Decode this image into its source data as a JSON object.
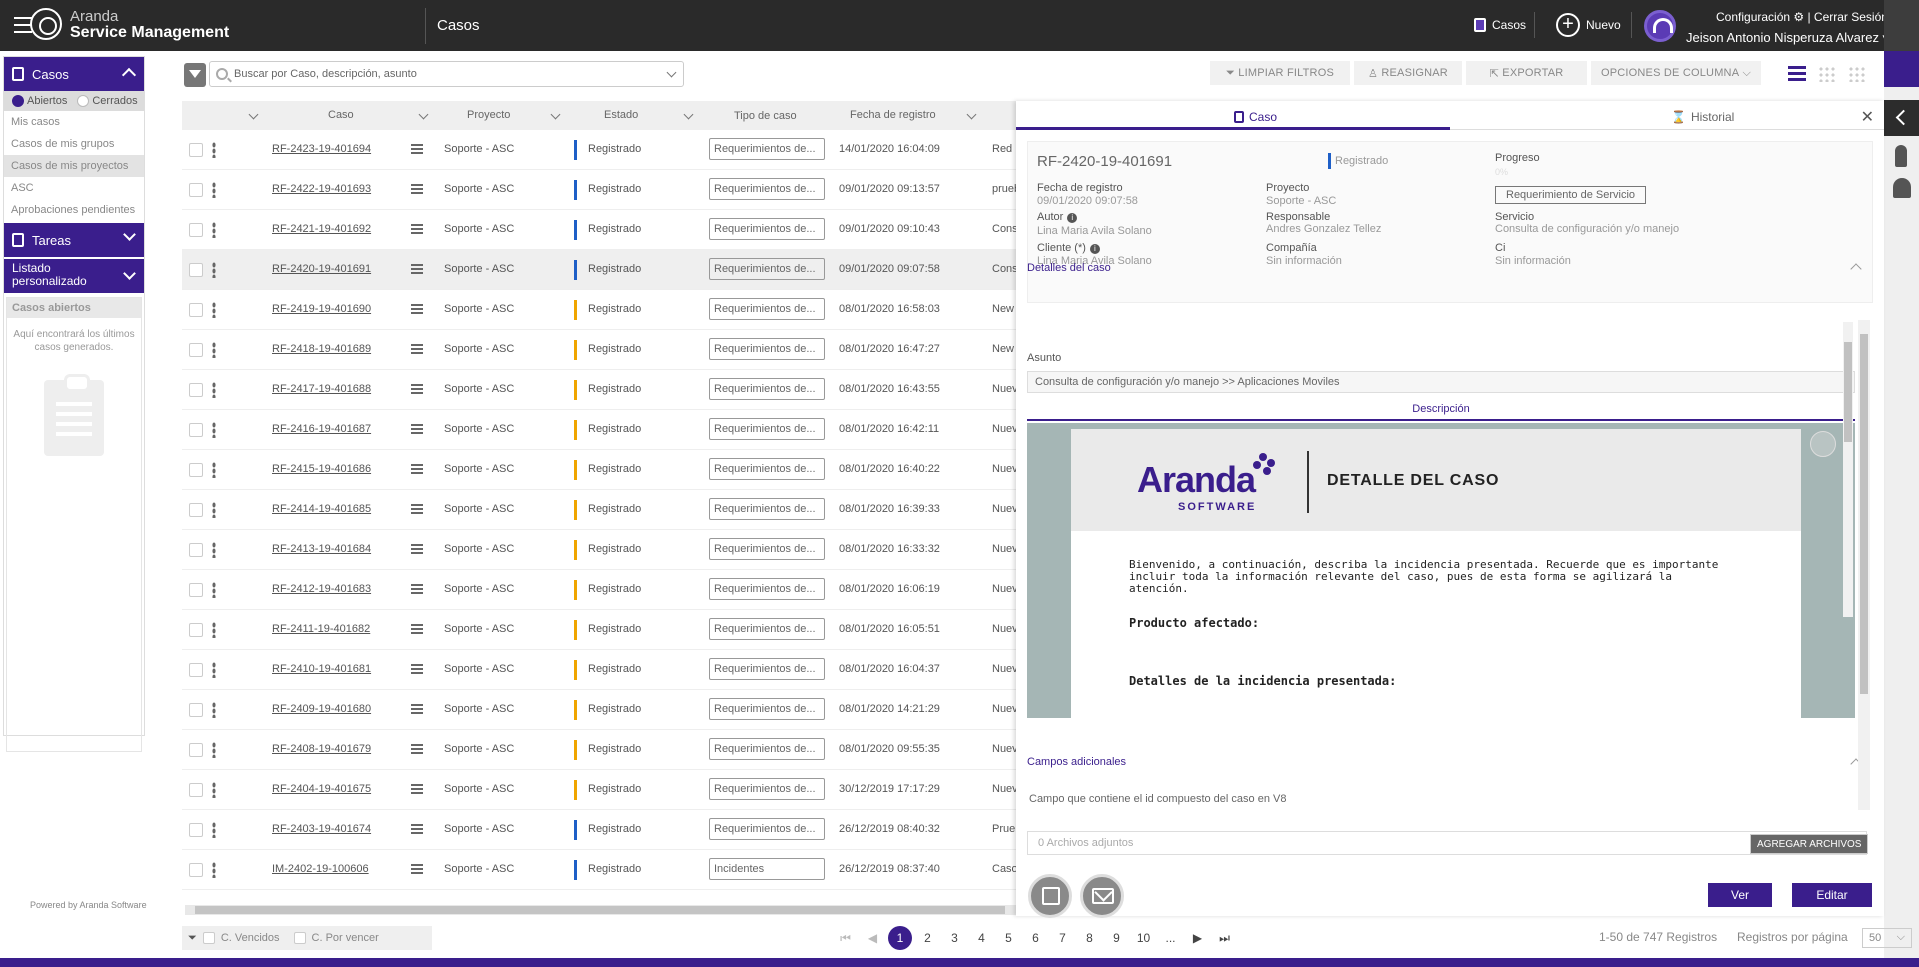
{
  "app": {
    "brand_line1": "Aranda",
    "brand_line2": "Service Management",
    "module_title": "Casos"
  },
  "topbar": {
    "casos_label": "Casos",
    "nuevo_label": "Nuevo",
    "config_label": "Configuración ⚙ | Cerrar Sesión",
    "user_name": "Jeison Antonio Nisperuza Alvarez ▾"
  },
  "sidebar": {
    "casos_label": "Casos",
    "radio_abiertos": "Abiertos",
    "radio_cerrados": "Cerrados",
    "links": [
      "Mis casos",
      "Casos de mis grupos",
      "Casos de mis proyectos",
      "ASC",
      "Aprobaciones pendientes"
    ],
    "tareas_label": "Tareas",
    "listado_label": "Listado personalizado",
    "card_title": "Casos abiertos",
    "card_text": "Aquí encontrará los últimos casos generados.",
    "powered": "Powered by Aranda Software"
  },
  "toolbar": {
    "search_placeholder": "Buscar por Caso, descripción, asunto",
    "limpiar": "LIMPIAR FILTROS",
    "reasignar": "REASIGNAR",
    "exportar": "EXPORTAR",
    "opciones": "OPCIONES DE COLUMNA"
  },
  "grid": {
    "headers": {
      "caso": "Caso",
      "proyecto": "Proyecto",
      "estado": "Estado",
      "tipo": "Tipo de caso",
      "fecha": "Fecha de registro"
    },
    "rows": [
      {
        "id": "RF-2423-19-401694",
        "proyecto": "Soporte - ASC",
        "estado": "Registrado",
        "tipo": "Requerimientos de...",
        "fecha": "14/01/2020 16:04:09",
        "extra": "Red",
        "bar": "#1e5fc7"
      },
      {
        "id": "RF-2422-19-401693",
        "proyecto": "Soporte - ASC",
        "estado": "Registrado",
        "tipo": "Requerimientos de...",
        "fecha": "09/01/2020 09:13:57",
        "extra": "prueba",
        "bar": "#1e5fc7"
      },
      {
        "id": "RF-2421-19-401692",
        "proyecto": "Soporte - ASC",
        "estado": "Registrado",
        "tipo": "Requerimientos de...",
        "fecha": "09/01/2020 09:10:43",
        "extra": "Consulta",
        "bar": "#1e5fc7"
      },
      {
        "id": "RF-2420-19-401691",
        "proyecto": "Soporte - ASC",
        "estado": "Registrado",
        "tipo": "Requerimientos de...",
        "fecha": "09/01/2020 09:07:58",
        "extra": "Consulta",
        "bar": "#1e5fc7"
      },
      {
        "id": "RF-2419-19-401690",
        "proyecto": "Soporte - ASC",
        "estado": "Registrado",
        "tipo": "Requerimientos de...",
        "fecha": "08/01/2020 16:58:03",
        "extra": "New",
        "bar": "#f0a500"
      },
      {
        "id": "RF-2418-19-401689",
        "proyecto": "Soporte - ASC",
        "estado": "Registrado",
        "tipo": "Requerimientos de...",
        "fecha": "08/01/2020 16:47:27",
        "extra": "New",
        "bar": "#f0a500"
      },
      {
        "id": "RF-2417-19-401688",
        "proyecto": "Soporte - ASC",
        "estado": "Registrado",
        "tipo": "Requerimientos de...",
        "fecha": "08/01/2020 16:43:55",
        "extra": "Nuevo",
        "bar": "#f0a500"
      },
      {
        "id": "RF-2416-19-401687",
        "proyecto": "Soporte - ASC",
        "estado": "Registrado",
        "tipo": "Requerimientos de...",
        "fecha": "08/01/2020 16:42:11",
        "extra": "Nuevo",
        "bar": "#f0a500"
      },
      {
        "id": "RF-2415-19-401686",
        "proyecto": "Soporte - ASC",
        "estado": "Registrado",
        "tipo": "Requerimientos de...",
        "fecha": "08/01/2020 16:40:22",
        "extra": "Nuevo",
        "bar": "#f0a500"
      },
      {
        "id": "RF-2414-19-401685",
        "proyecto": "Soporte - ASC",
        "estado": "Registrado",
        "tipo": "Requerimientos de...",
        "fecha": "08/01/2020 16:39:33",
        "extra": "Nuevo",
        "bar": "#f0a500"
      },
      {
        "id": "RF-2413-19-401684",
        "proyecto": "Soporte - ASC",
        "estado": "Registrado",
        "tipo": "Requerimientos de...",
        "fecha": "08/01/2020 16:33:32",
        "extra": "Nuevo",
        "bar": "#f0a500"
      },
      {
        "id": "RF-2412-19-401683",
        "proyecto": "Soporte - ASC",
        "estado": "Registrado",
        "tipo": "Requerimientos de...",
        "fecha": "08/01/2020 16:06:19",
        "extra": "Nuevo",
        "bar": "#f0a500"
      },
      {
        "id": "RF-2411-19-401682",
        "proyecto": "Soporte - ASC",
        "estado": "Registrado",
        "tipo": "Requerimientos de...",
        "fecha": "08/01/2020 16:05:51",
        "extra": "Nuevo",
        "bar": "#f0a500"
      },
      {
        "id": "RF-2410-19-401681",
        "proyecto": "Soporte - ASC",
        "estado": "Registrado",
        "tipo": "Requerimientos de...",
        "fecha": "08/01/2020 16:04:37",
        "extra": "Nuevo",
        "bar": "#f0a500"
      },
      {
        "id": "RF-2409-19-401680",
        "proyecto": "Soporte - ASC",
        "estado": "Registrado",
        "tipo": "Requerimientos de...",
        "fecha": "08/01/2020 14:21:29",
        "extra": "Nuevo",
        "bar": "#f0a500"
      },
      {
        "id": "RF-2408-19-401679",
        "proyecto": "Soporte - ASC",
        "estado": "Registrado",
        "tipo": "Requerimientos de...",
        "fecha": "08/01/2020 09:55:35",
        "extra": "Nuevo",
        "bar": "#f0a500"
      },
      {
        "id": "RF-2404-19-401675",
        "proyecto": "Soporte - ASC",
        "estado": "Registrado",
        "tipo": "Requerimientos de...",
        "fecha": "30/12/2019 17:17:29",
        "extra": "Nuevo",
        "bar": "#f0a500"
      },
      {
        "id": "RF-2403-19-401674",
        "proyecto": "Soporte - ASC",
        "estado": "Registrado",
        "tipo": "Requerimientos de...",
        "fecha": "26/12/2019 08:40:32",
        "extra": "Prueba",
        "bar": "#1e5fc7"
      },
      {
        "id": "IM-2402-19-100606",
        "proyecto": "Soporte - ASC",
        "estado": "Registrado",
        "tipo": "Incidentes",
        "fecha": "26/12/2019 08:37:40",
        "extra": "Caso",
        "bar": "#1e5fc7"
      }
    ]
  },
  "bottom": {
    "vencidos": "C. Vencidos",
    "por_vencer": "C. Por vencer",
    "pages": [
      "1",
      "2",
      "3",
      "4",
      "5",
      "6",
      "7",
      "8",
      "9",
      "10",
      "..."
    ],
    "registros": "1-50 de 747 Registros",
    "registros_pp_label": "Registros por página",
    "registros_pp_value": "50"
  },
  "panel": {
    "tab_caso": "Caso",
    "tab_historial": "Historial",
    "case_id": "RF-2420-19-401691",
    "estado": "Registrado",
    "progreso_label": "Progreso",
    "progreso_value": "0%",
    "fecha_label": "Fecha de registro",
    "fecha_value": "09/01/2020 09:07:58",
    "proyecto_label": "Proyecto",
    "proyecto_value": "Soporte - ASC",
    "tipo_badge": "Requerimiento de Servicio",
    "autor_label": "Autor",
    "autor_value": "Lina Maria Avila Solano",
    "responsable_label": "Responsable",
    "responsable_value": "Andres Gonzalez Tellez",
    "servicio_label": "Servicio",
    "servicio_value": "Consulta de configuración y/o manejo",
    "cliente_label": "Cliente (*)",
    "cliente_value": "Lina Maria Avila Solano",
    "compania_label": "Compañía",
    "compania_value": "Sin información",
    "ci_label": "Ci",
    "ci_value": "Sin información",
    "detalles_title": "Detalles del caso",
    "asunto_label": "Asunto",
    "asunto_value": "Consulta de configuración y/o manejo >> Aplicaciones Moviles",
    "descripcion_tab": "Descripción",
    "doc_brand": "Aranda",
    "doc_brand_sub": "SOFTWARE",
    "doc_title": "DETALLE DEL CASO",
    "doc_intro": "Bienvenido, a continuación, describa la incidencia presentada. Recuerde que es importante incluir toda la información relevante del caso, pues de esta forma se agilizará la atención.",
    "doc_producto": "Producto afectado:",
    "doc_detalles": "Detalles de la incidencia presentada:",
    "campos_title": "Campos adicionales",
    "campo_text": "Campo que contiene el id compuesto del caso en V8",
    "adjuntos": "0 Archivos adjuntos",
    "agregar": "AGREGAR ARCHIVOS",
    "ver": "Ver",
    "editar": "Editar"
  }
}
